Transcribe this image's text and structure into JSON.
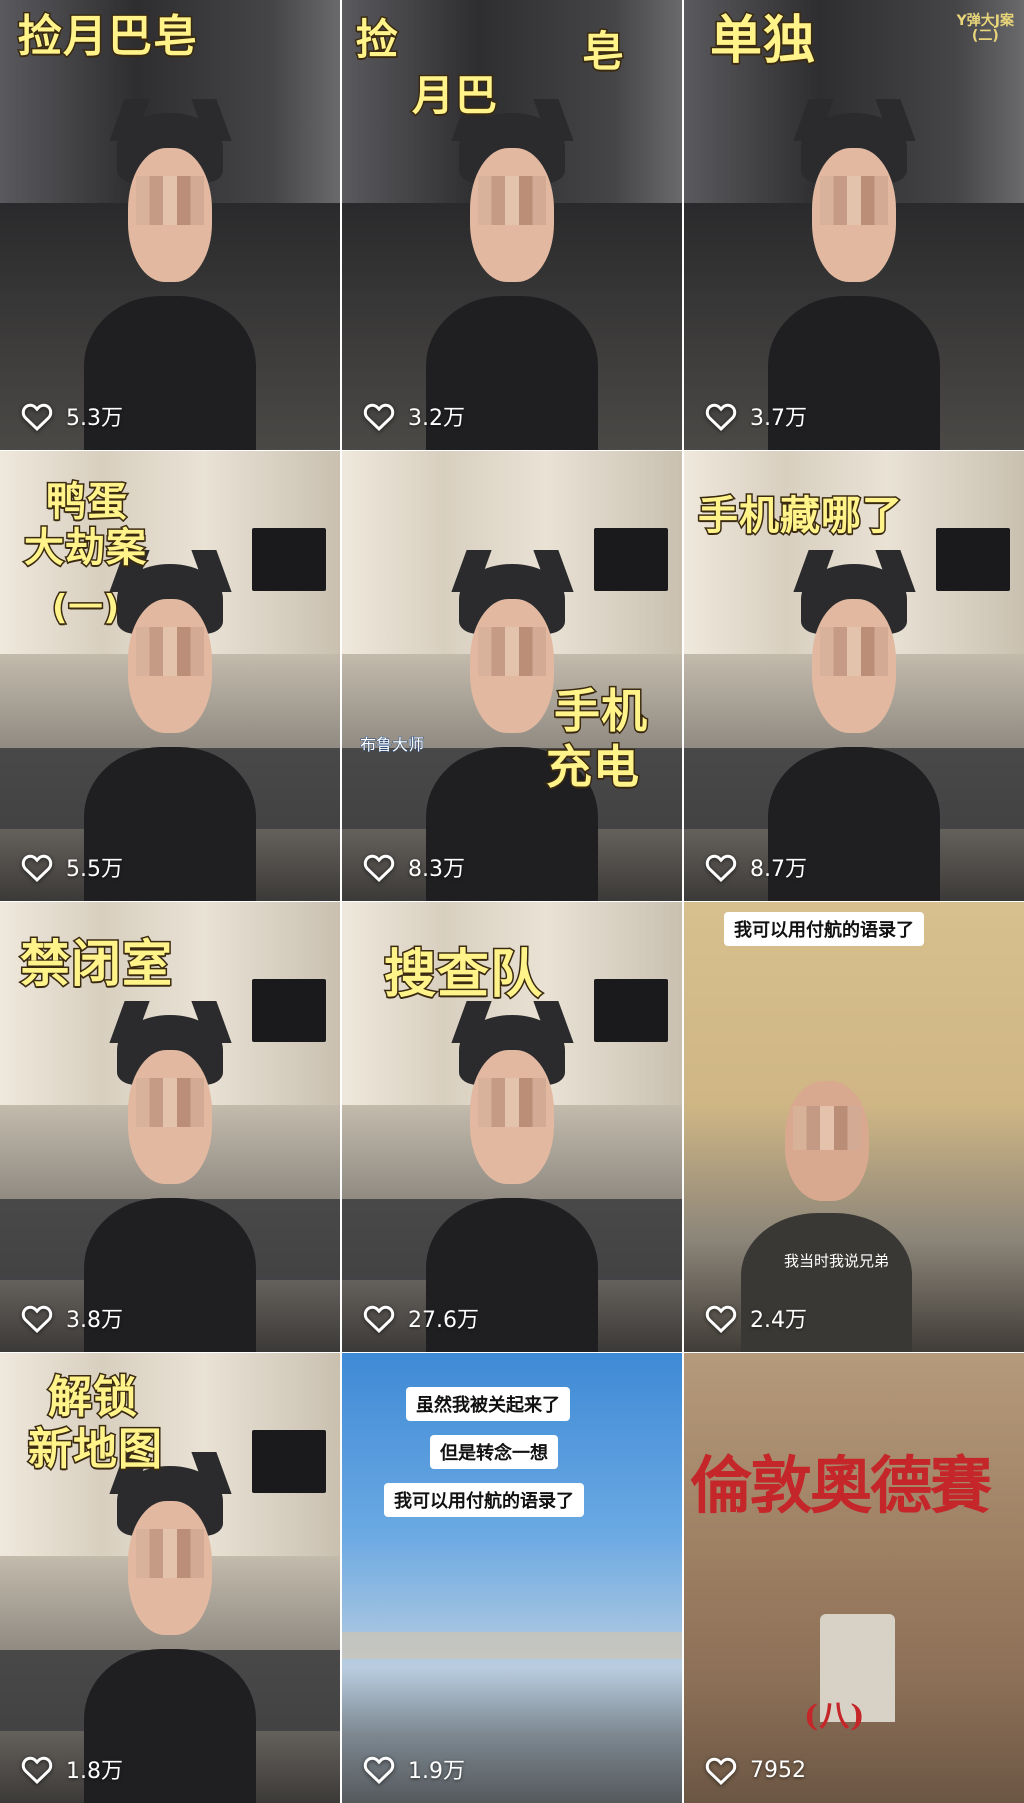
{
  "tiles": [
    {
      "caption": "捡月巴皂",
      "likes": "5.3万"
    },
    {
      "caption_a": "捡",
      "caption_b": "皂",
      "caption_c": "月巴",
      "likes": "3.2万"
    },
    {
      "caption": "单独",
      "corner_note": "Y弹大J案\n(二)",
      "likes": "3.7万"
    },
    {
      "caption_a": "鸭蛋",
      "caption_b": "大劫案",
      "caption_c": "(一)",
      "likes": "5.5万"
    },
    {
      "caption_a": "手机",
      "caption_b": "充电",
      "side_label": "布鲁大师",
      "likes": "8.3万"
    },
    {
      "caption": "手机藏哪了",
      "likes": "8.7万"
    },
    {
      "caption": "禁闭室",
      "likes": "3.8万"
    },
    {
      "caption": "搜查队",
      "likes": "27.6万"
    },
    {
      "chip": "我可以用付航的语录了",
      "subtitle": "我当时我说兄弟",
      "likes": "2.4万"
    },
    {
      "caption_a": "解锁",
      "caption_b": "新地图",
      "likes": "1.8万"
    },
    {
      "chips": [
        "虽然我被关起来了",
        "但是转念一想",
        "我可以用付航的语录了"
      ],
      "likes": "1.9万"
    },
    {
      "caption": "倫敦奧德賽",
      "caption_b": "(八)",
      "likes": "7952"
    }
  ],
  "icon": "heart-outline-icon",
  "colors": {
    "caption_fill": "#fff38a",
    "caption_stroke": "#3a2a10",
    "title_red": "#c4262a"
  }
}
